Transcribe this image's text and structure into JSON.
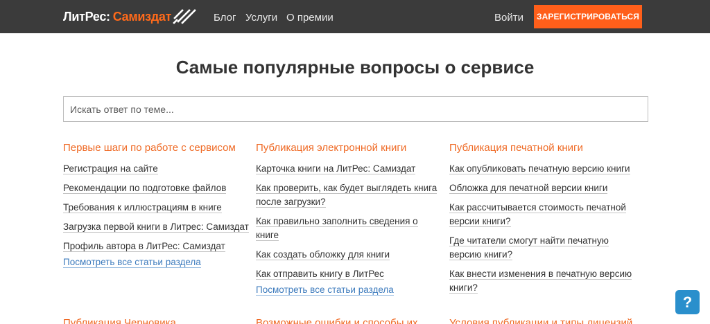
{
  "header": {
    "logo_part1": "ЛитРес:",
    "logo_part2": "Самиздат",
    "nav": [
      "Блог",
      "Услуги",
      "О премии"
    ],
    "login": "Войти",
    "register": "ЗАРЕГИСТРИРОВАТЬСЯ"
  },
  "page_title": "Самые популярные вопросы о сервисе",
  "search": {
    "placeholder": "Искать ответ по теме..."
  },
  "sections": [
    {
      "title": "Первые шаги по работе с сервисом",
      "items": [
        "Регистрация на сайте",
        "Рекомендации по подготовке файлов",
        "Требования к иллюстрациям в книге",
        "Загрузка первой книги в Литрес: Самиздат",
        "Профиль автора в ЛитРес: Самиздат"
      ],
      "more": "Посмотреть все статьи раздела"
    },
    {
      "title": "Публикация электронной книги",
      "items": [
        "Карточка книги на ЛитРес: Самиздат",
        "Как проверить, как будет выглядеть книга после загрузки?",
        "Как правильно заполнить сведения о книге",
        "Как создать обложку для книги",
        "Как отправить книгу в ЛитРес"
      ],
      "more": "Посмотреть все статьи раздела"
    },
    {
      "title": "Публикация печатной книги",
      "items": [
        "Как опубликовать печатную версию книги",
        "Обложка для печатной версии книги",
        "Как рассчитывается стоимость печатной версии книги?",
        "Где читатели смогут найти печатную версию книги?",
        "Как внести изменения в печатную версию книги?"
      ]
    }
  ],
  "bottom_sections": [
    "Публикация Черновика",
    "Возможные ошибки и способы их",
    "Условия публикации и типы лицензий"
  ],
  "help": "?"
}
